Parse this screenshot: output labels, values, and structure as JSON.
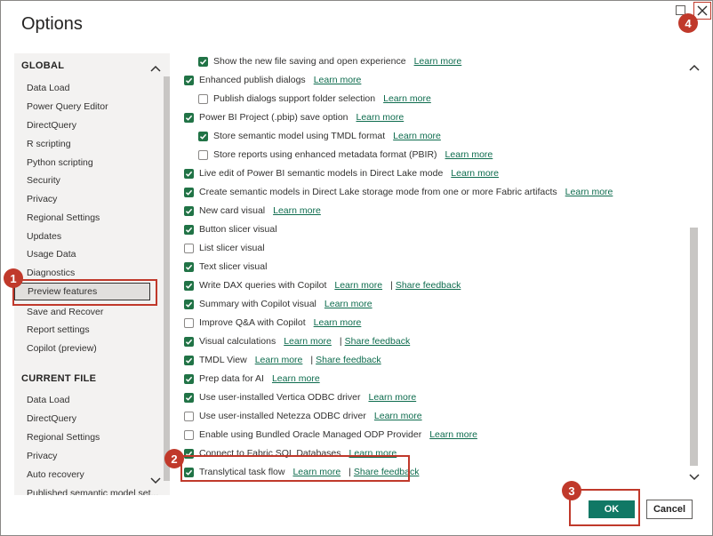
{
  "dialog": {
    "title": "Options"
  },
  "nav": {
    "global_heading": "GLOBAL",
    "global_items": [
      "Data Load",
      "Power Query Editor",
      "DirectQuery",
      "R scripting",
      "Python scripting",
      "Security",
      "Privacy",
      "Regional Settings",
      "Updates",
      "Usage Data",
      "Diagnostics",
      "Preview features",
      "Save and Recover",
      "Report settings",
      "Copilot (preview)"
    ],
    "selected_item": "Preview features",
    "current_file_heading": "CURRENT FILE",
    "current_file_items": [
      "Data Load",
      "DirectQuery",
      "Regional Settings",
      "Privacy",
      "Auto recovery",
      "Published semantic model set..."
    ]
  },
  "features": [
    {
      "label": "Show the new file saving and open experience",
      "checked": true,
      "indent": true,
      "learn": "Learn more"
    },
    {
      "label": "Enhanced publish dialogs",
      "checked": true,
      "indent": false,
      "learn": "Learn more"
    },
    {
      "label": "Publish dialogs support folder selection",
      "checked": false,
      "indent": true,
      "learn": "Learn more"
    },
    {
      "label": "Power BI Project (.pbip) save option",
      "checked": true,
      "indent": false,
      "learn": "Learn more"
    },
    {
      "label": "Store semantic model using TMDL format",
      "checked": true,
      "indent": true,
      "learn": "Learn more"
    },
    {
      "label": "Store reports using enhanced metadata format (PBIR)",
      "checked": false,
      "indent": true,
      "learn": "Learn more"
    },
    {
      "label": "Live edit of Power BI semantic models in Direct Lake mode",
      "checked": true,
      "indent": false,
      "learn": "Learn more"
    },
    {
      "label": "Create semantic models in Direct Lake storage mode from one or more Fabric artifacts",
      "checked": true,
      "indent": false,
      "learn": "Learn more"
    },
    {
      "label": "New card visual",
      "checked": true,
      "indent": false,
      "learn": "Learn more"
    },
    {
      "label": "Button slicer visual",
      "checked": true,
      "indent": false
    },
    {
      "label": "List slicer visual",
      "checked": false,
      "indent": false
    },
    {
      "label": "Text slicer visual",
      "checked": true,
      "indent": false
    },
    {
      "label": "Write DAX queries with Copilot",
      "checked": true,
      "indent": false,
      "learn": "Learn more",
      "feedback": "Share feedback"
    },
    {
      "label": "Summary with Copilot visual",
      "checked": true,
      "indent": false,
      "learn": "Learn more"
    },
    {
      "label": "Improve Q&A with Copilot",
      "checked": false,
      "indent": false,
      "learn": "Learn more"
    },
    {
      "label": "Visual calculations",
      "checked": true,
      "indent": false,
      "learn": "Learn more",
      "feedback": "Share feedback"
    },
    {
      "label": "TMDL View",
      "checked": true,
      "indent": false,
      "learn": "Learn more",
      "feedback": "Share feedback"
    },
    {
      "label": "Prep data for AI",
      "checked": true,
      "indent": false,
      "learn": "Learn more"
    },
    {
      "label": "Use user-installed Vertica ODBC driver",
      "checked": true,
      "indent": false,
      "learn": "Learn more"
    },
    {
      "label": "Use user-installed Netezza ODBC driver",
      "checked": false,
      "indent": false,
      "learn": "Learn more"
    },
    {
      "label": "Enable using Bundled Oracle Managed ODP Provider",
      "checked": false,
      "indent": false,
      "learn": "Learn more"
    },
    {
      "label": "Connect to Fabric SQL Databases",
      "checked": true,
      "indent": false,
      "learn": "Learn more"
    },
    {
      "label": "Translytical task flow",
      "checked": true,
      "indent": false,
      "learn": "Learn more",
      "feedback": "Share feedback"
    }
  ],
  "buttons": {
    "ok": "OK",
    "cancel": "Cancel"
  },
  "callouts": [
    "1",
    "2",
    "3",
    "4"
  ],
  "icons": {
    "close": "close-icon",
    "maximize": "maximize-icon",
    "nav_up": "chevron-up-icon",
    "nav_down": "chevron-down-icon",
    "content_up": "chevron-up-icon",
    "content_down": "chevron-down-icon",
    "check": "checkmark-icon"
  },
  "colors": {
    "accent": "#117865",
    "checkbox": "#217346",
    "link": "#0e6c4e",
    "callout": "#c0392b"
  }
}
